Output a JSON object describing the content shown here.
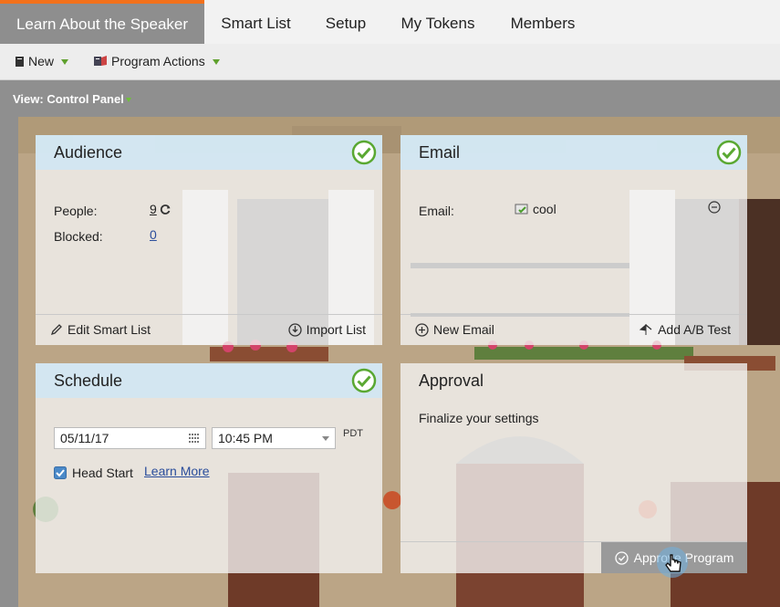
{
  "tabs": [
    {
      "label": "Learn About the Speaker",
      "active": true
    },
    {
      "label": "Smart List"
    },
    {
      "label": "Setup"
    },
    {
      "label": "My Tokens"
    },
    {
      "label": "Members"
    }
  ],
  "toolbar": {
    "new_label": "New",
    "program_actions_label": "Program Actions"
  },
  "view": {
    "label": "View: Control Panel"
  },
  "audience": {
    "title": "Audience",
    "people_label": "People:",
    "people_value": "9",
    "blocked_label": "Blocked:",
    "blocked_value": "0",
    "edit_label": "Edit Smart List",
    "import_label": "Import List"
  },
  "email": {
    "title": "Email",
    "email_label": "Email:",
    "email_name": "cool",
    "new_label": "New Email",
    "ab_label": "Add A/B Test"
  },
  "schedule": {
    "title": "Schedule",
    "date": "05/11/17",
    "time": "10:45 PM",
    "tz": "PDT",
    "head_start_label": "Head Start",
    "learn_more": "Learn More"
  },
  "approval": {
    "title": "Approval",
    "message": "Finalize your settings",
    "approve_label": "Approve Program"
  },
  "colors": {
    "accent": "#f3711b",
    "check": "#5aa832",
    "link": "#2a4d9b"
  }
}
